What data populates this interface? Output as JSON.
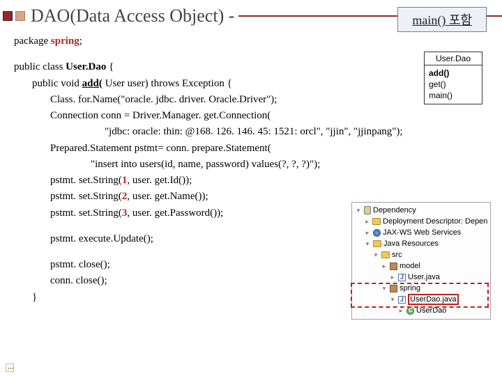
{
  "title": "DAO(Data Access Object) -",
  "main_badge": "main() 포함",
  "class_diagram": {
    "name": "User.Dao",
    "methods": {
      "add": "add()",
      "get": "get()",
      "main": "main()"
    }
  },
  "code": {
    "l1a": "package ",
    "l1b": "spring",
    "l1c": ";",
    "l2a": "public class ",
    "l2b": "User.Dao",
    "l2c": " {",
    "l3a": "public void ",
    "l3b": "add(",
    "l3c": " User user)  throws  Exception {",
    "l4": "Class. for.Name(\"oracle. jdbc. driver. Oracle.Driver\");",
    "l5": "Connection conn = Driver.Manager. get.Connection(",
    "l6": "\"jdbc: oracle: thin: @168. 126. 146. 45: 1521: orcl\", \"jjin\", \"jjinpang\");",
    "l7": "Prepared.Statement pstmt= conn. prepare.Statement(",
    "l8": "\"insert into users(id, name, password) values(?, ?, ?)\");",
    "l9a": "pstmt. set.String(",
    "l9n": "1",
    "l9b": ", user. get.Id());",
    "l10a": "pstmt. set.String(",
    "l10n": "2",
    "l10b": ", user. get.Name());",
    "l11a": "pstmt. set.String(",
    "l11n": "3",
    "l11b": ", user. get.Password());",
    "l12": "pstmt. execute.Update();",
    "l13": "pstmt. close();",
    "l14": "conn. close();",
    "l15": "}"
  },
  "tree": {
    "n1": "Dependency",
    "n2": "Deployment Descriptor: Dependency",
    "n3": "JAX-WS Web Services",
    "n4": "Java Resources",
    "n5": "src",
    "n6": "model",
    "n7": "User.java",
    "n8": "spring",
    "n9": "UserDao.java",
    "n10": "UserDao"
  }
}
